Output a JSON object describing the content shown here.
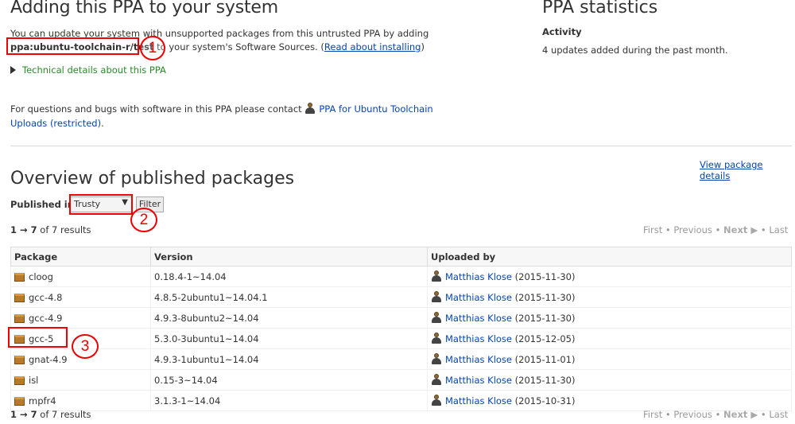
{
  "adding": {
    "title": "Adding this PPA to your system",
    "intro_line1": "You can update your system with unsupported packages from this untrusted PPA by adding",
    "ppa_code": "ppa:ubuntu-toolchain-r/test",
    "intro_line2_rest": " to your system's Software Sources. (",
    "read_about_link": "Read about installing",
    "paren_close": ")",
    "technical_details": "Technical details about this PPA",
    "contact_text": "For questions and bugs with software in this PPA please contact ",
    "contact_link_part1": "PPA for Ubuntu Toolchain",
    "contact_link_part2": "Uploads (restricted)",
    "contact_end": "."
  },
  "stats": {
    "title": "PPA statistics",
    "activity_label": "Activity",
    "activity_text": "4 updates added during the past month."
  },
  "overview": {
    "title": "Overview of published packages",
    "view_package_details": "View package details",
    "published_in_label": "Published in:",
    "series_selected": "Trusty",
    "filter_button": "Filter",
    "results_range": "1 → 7",
    "results_of": " of 7 results",
    "pager": {
      "first": "First",
      "previous": "Previous",
      "next": "Next",
      "last": "Last"
    }
  },
  "table": {
    "headers": [
      "Package",
      "Version",
      "Uploaded by"
    ],
    "rows": [
      {
        "package": "cloog",
        "version": "0.18.4-1~14.04",
        "uploader": "Matthias Klose",
        "date": " (2015-11-30)"
      },
      {
        "package": "gcc-4.8",
        "version": "4.8.5-2ubuntu1~14.04.1",
        "uploader": "Matthias Klose",
        "date": " (2015-11-30)"
      },
      {
        "package": "gcc-4.9",
        "version": "4.9.3-8ubuntu2~14.04",
        "uploader": "Matthias Klose",
        "date": " (2015-11-30)"
      },
      {
        "package": "gcc-5",
        "version": "5.3.0-3ubuntu1~14.04",
        "uploader": "Matthias Klose",
        "date": " (2015-12-05)"
      },
      {
        "package": "gnat-4.9",
        "version": "4.9.3-1ubuntu1~14.04",
        "uploader": "Matthias Klose",
        "date": " (2015-11-01)"
      },
      {
        "package": "isl",
        "version": "0.15-3~14.04",
        "uploader": "Matthias Klose",
        "date": " (2015-11-30)"
      },
      {
        "package": "mpfr4",
        "version": "3.1.3-1~14.04",
        "uploader": "Matthias Klose",
        "date": " (2015-10-31)"
      }
    ]
  },
  "annotations": {
    "marker1": "1",
    "marker2": "2",
    "marker3": "3",
    "color": "#e00000"
  },
  "icons": {
    "technical_toggle": "triangle-right-icon",
    "team": "team-person-icon",
    "package": "package-box-icon",
    "uploader": "person-icon",
    "next_arrow": "play-triangle-icon"
  }
}
